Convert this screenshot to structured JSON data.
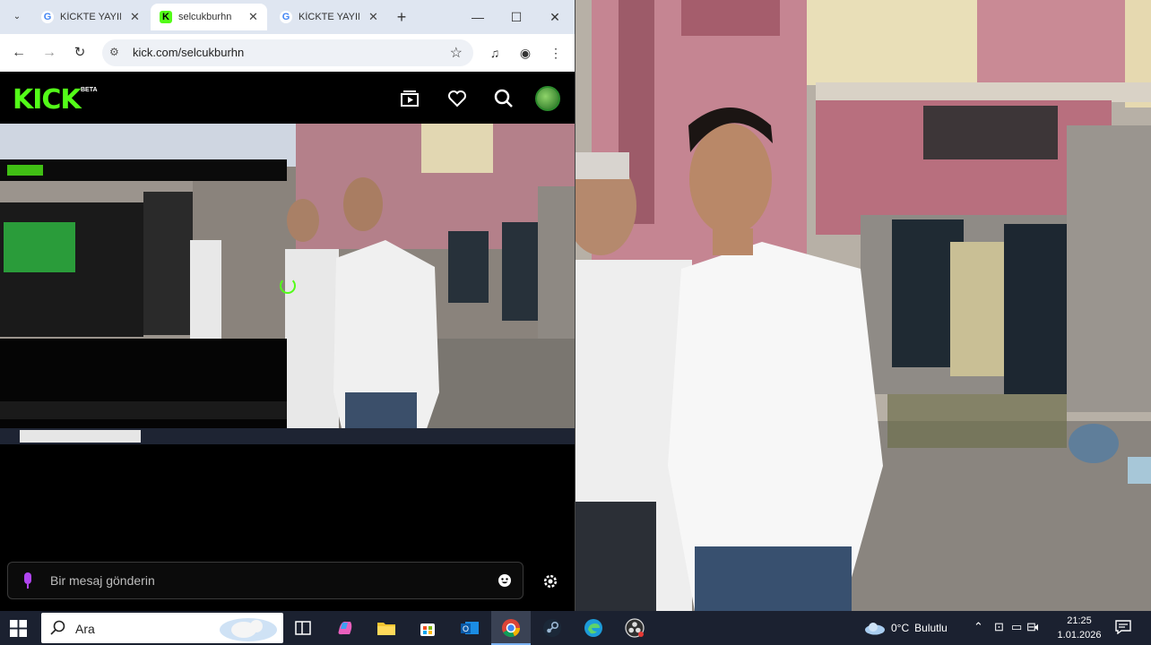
{
  "browser": {
    "tabs": [
      {
        "title": "KİCKTE YAYIN",
        "favicon": "google-icon",
        "active": false
      },
      {
        "title": "selcukburhn",
        "favicon": "kick-icon",
        "active": true
      },
      {
        "title": "KİCKTE YAYIN",
        "favicon": "google-icon",
        "active": false
      }
    ],
    "new_tab_label": "+",
    "url": "kick.com/selcukburhn"
  },
  "kick": {
    "logo": "KICK",
    "beta_badge": "BETA",
    "chat_placeholder": "Bir mesaj gönderin",
    "accent_color": "#53fc18"
  },
  "taskbar": {
    "search_placeholder": "Ara",
    "apps": [
      "task-view-icon",
      "copilot-icon",
      "file-explorer-icon",
      "microsoft-store-icon",
      "outlook-icon",
      "chrome-icon",
      "steam-icon",
      "edge-icon",
      "obs-icon"
    ],
    "weather_temp": "0°C",
    "weather_text": "Bulutlu",
    "time": "21:25",
    "date": "1.01.2026"
  }
}
